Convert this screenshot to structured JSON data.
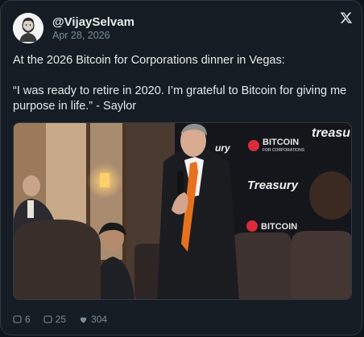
{
  "author": {
    "handle": "@VijaySelvam",
    "date": "Apr 28, 2026"
  },
  "platform_icon": "x-logo-icon",
  "tweet": {
    "line1": "At the 2026 Bitcoin for Corporations dinner in Vegas:",
    "line2": "“I was ready to retire in 2020. I’m grateful to Bitcoin for giving me purpose in life.” - Saylor"
  },
  "media": {
    "kind": "photo",
    "backdrop_texts": [
      "BITCOIN",
      "FOR CORPORATIONS",
      "Treasury",
      "treasu",
      "BITCOIN",
      "ury"
    ]
  },
  "actions": {
    "replies": "6",
    "reposts": "25",
    "likes": "304"
  },
  "colors": {
    "background": "#151c24",
    "text": "#e7e9ea",
    "muted": "#7d8b98",
    "border": "#2f3a44"
  }
}
